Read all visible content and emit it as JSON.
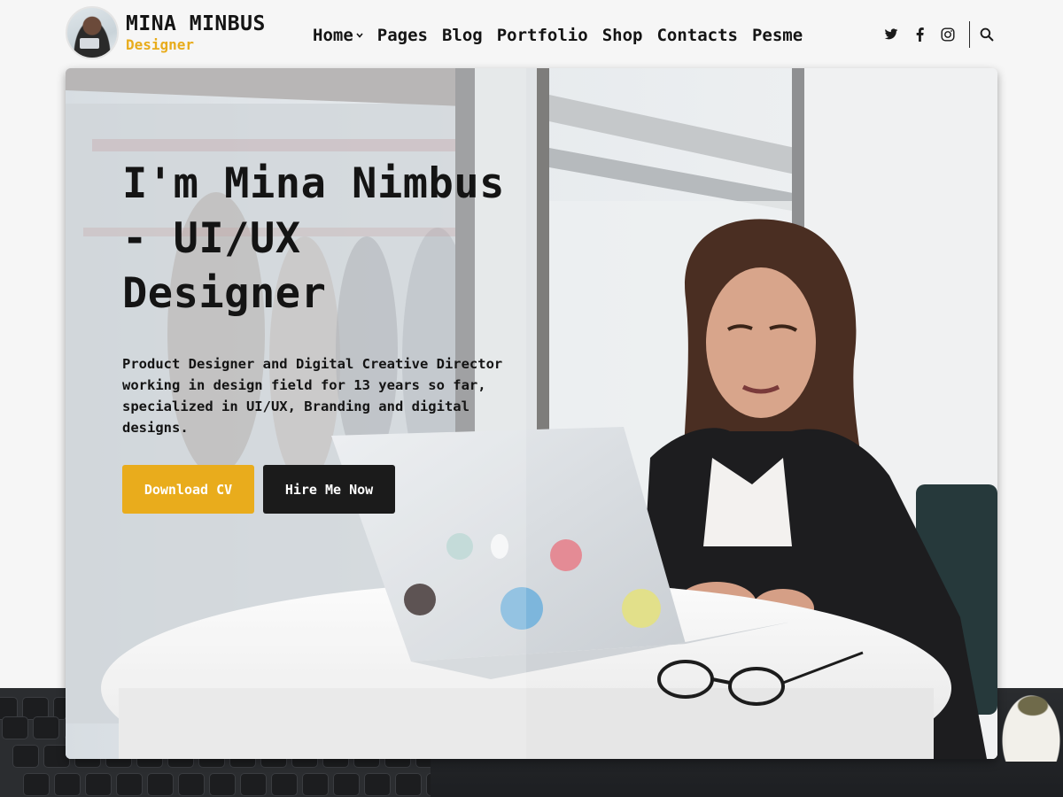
{
  "brand": {
    "name": "MINA MINBUS",
    "role": "Designer"
  },
  "nav": {
    "items": [
      {
        "label": "Home",
        "has_dropdown": true
      },
      {
        "label": "Pages"
      },
      {
        "label": "Blog"
      },
      {
        "label": "Portfolio"
      },
      {
        "label": "Shop"
      },
      {
        "label": "Contacts"
      },
      {
        "label": "Pesme"
      }
    ]
  },
  "social": {
    "icons": [
      "twitter-icon",
      "facebook-icon",
      "instagram-icon"
    ],
    "search_icon": "search-icon"
  },
  "hero": {
    "title": "I'm Mina Nimbus - UI/UX Designer",
    "description": "Product Designer and Digital Creative Director working in design field for 13 years so far, specialized in UI/UX, Branding and digital designs.",
    "buttons": {
      "download_cv": "Download CV",
      "hire_me": "Hire Me Now"
    }
  },
  "colors": {
    "accent": "#e9ac1c",
    "dark": "#1b1b1b",
    "background": "#f6f6f6"
  }
}
